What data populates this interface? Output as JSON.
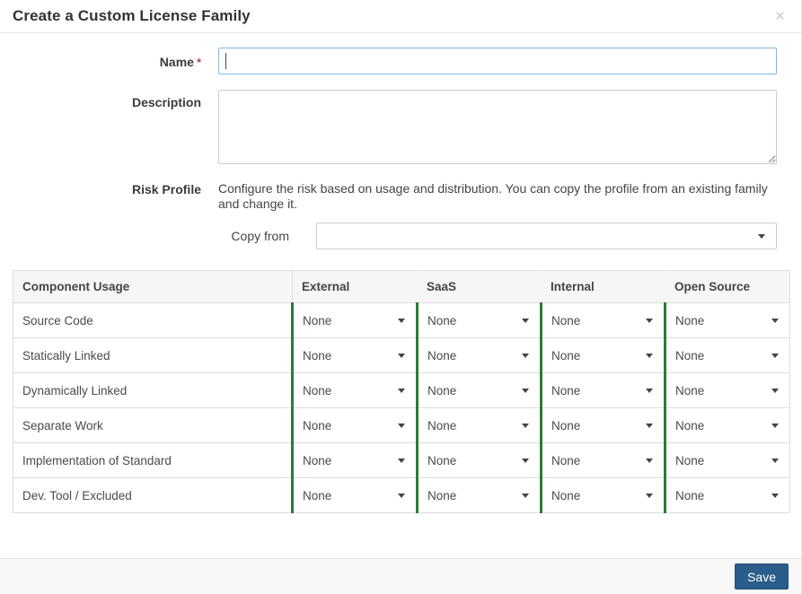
{
  "modal": {
    "title": "Create a Custom License Family",
    "close_glyph": "×"
  },
  "form": {
    "name": {
      "label": "Name",
      "required_marker": "*",
      "value": ""
    },
    "description": {
      "label": "Description",
      "value": ""
    },
    "risk_profile": {
      "label": "Risk Profile",
      "help_text": "Configure the risk based on usage and distribution. You can copy the profile from an existing family and change it.",
      "copy_from": {
        "label": "Copy from",
        "selected_value": ""
      }
    }
  },
  "table": {
    "columns": [
      "Component Usage",
      "External",
      "SaaS",
      "Internal",
      "Open Source"
    ],
    "rows": [
      {
        "label": "Source Code",
        "values": [
          "None",
          "None",
          "None",
          "None"
        ]
      },
      {
        "label": "Statically Linked",
        "values": [
          "None",
          "None",
          "None",
          "None"
        ]
      },
      {
        "label": "Dynamically Linked",
        "values": [
          "None",
          "None",
          "None",
          "None"
        ]
      },
      {
        "label": "Separate Work",
        "values": [
          "None",
          "None",
          "None",
          "None"
        ]
      },
      {
        "label": "Implementation of Standard",
        "values": [
          "None",
          "None",
          "None",
          "None"
        ]
      },
      {
        "label": "Dev. Tool / Excluded",
        "values": [
          "None",
          "None",
          "None",
          "None"
        ]
      }
    ]
  },
  "footer": {
    "save_label": "Save"
  },
  "colors": {
    "risk_none_green": "#2f7a37",
    "save_button_blue": "#2a5d8b",
    "focused_input_border": "#7eb9e4",
    "required_marker_red": "#b94a48"
  }
}
